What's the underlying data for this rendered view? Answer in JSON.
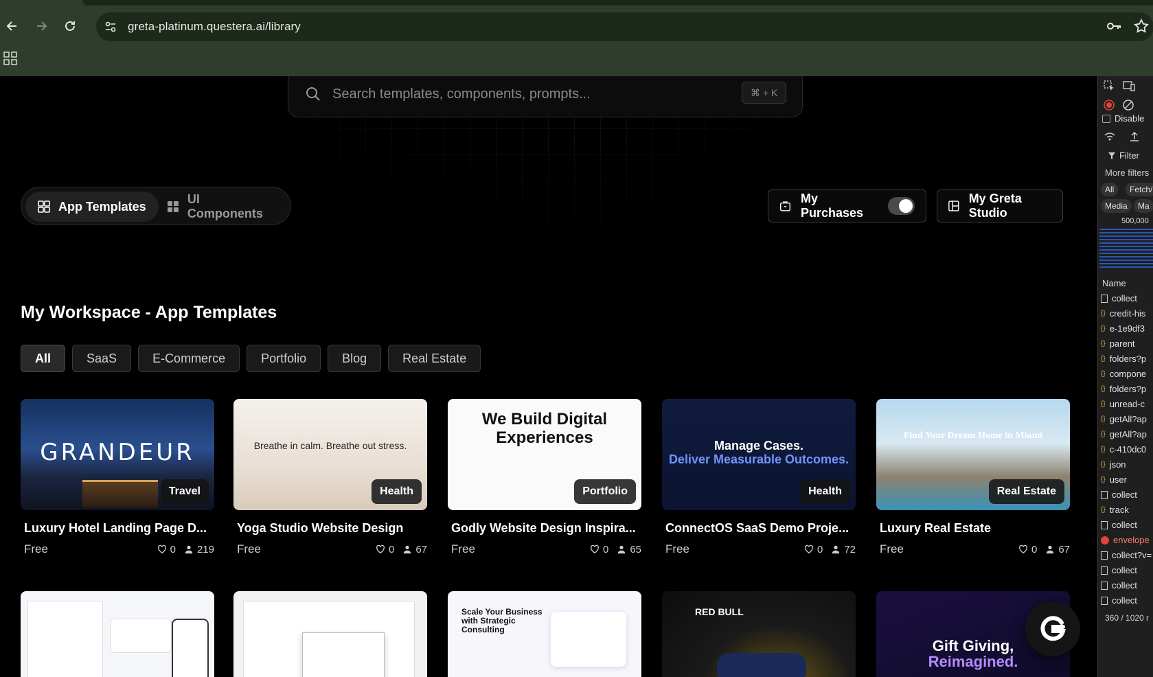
{
  "browser": {
    "url": "greta-platinum.questera.ai/library"
  },
  "search": {
    "placeholder": "Search templates, components, prompts...",
    "shortcut": "⌘ + K"
  },
  "segments": [
    {
      "label": "App Templates",
      "active": true
    },
    {
      "label": "UI Components",
      "active": false
    }
  ],
  "actions": {
    "purchases_label": "My Purchases",
    "purchases_toggle_on": true,
    "studio_label": "My Greta Studio"
  },
  "section": {
    "title": "My Workspace - App Templates"
  },
  "filters": [
    {
      "label": "All",
      "active": true
    },
    {
      "label": "SaaS",
      "active": false
    },
    {
      "label": "E-Commerce",
      "active": false
    },
    {
      "label": "Portfolio",
      "active": false
    },
    {
      "label": "Blog",
      "active": false
    },
    {
      "label": "Real Estate",
      "active": false
    }
  ],
  "cards": [
    {
      "title": "Luxury Hotel Landing Page D...",
      "tag": "Travel",
      "price": "Free",
      "likes": "0",
      "users": "219",
      "thumb_text": "GRANDEUR"
    },
    {
      "title": "Yoga Studio Website Design",
      "tag": "Health",
      "price": "Free",
      "likes": "0",
      "users": "67",
      "thumb_text": "Breathe in calm. Breathe out stress."
    },
    {
      "title": "Godly Website Design Inspira...",
      "tag": "Portfolio",
      "price": "Free",
      "likes": "0",
      "users": "65",
      "thumb_text": "We Build Digital Experiences"
    },
    {
      "title": "ConnectOS SaaS Demo Proje...",
      "tag": "Health",
      "price": "Free",
      "likes": "0",
      "users": "72",
      "thumb_text_1": "Manage Cases.",
      "thumb_text_2": "Deliver Measurable Outcomes."
    },
    {
      "title": "Luxury Real Estate",
      "tag": "Real Estate",
      "price": "Free",
      "likes": "0",
      "users": "67",
      "thumb_text": "Find Your Dream Home in Miami"
    }
  ],
  "cards_row2": [
    {
      "thumb_text": ""
    },
    {
      "thumb_text": ""
    },
    {
      "thumb_text": "Scale Your Business with Strategic Consulting"
    },
    {
      "thumb_text": "RED BULL"
    },
    {
      "thumb_text_1": "Gift Giving,",
      "thumb_text_2": "Reimagined."
    }
  ],
  "devtools": {
    "disable": "Disable",
    "filter": "Filter",
    "more_filters": "More filters",
    "chips": [
      "All",
      "Fetch/",
      "Media",
      "Ma"
    ],
    "scale": "500,000",
    "name_header": "Name",
    "requests": [
      "collect",
      "credit-his",
      "e-1e9df3",
      "parent",
      "folders?p",
      "compone",
      "folders?p",
      "unread-c",
      "getAll?ap",
      "getAll?ap",
      "c-410dc0",
      "json",
      "user",
      "collect",
      "track",
      "collect",
      "envelope",
      "collect?v=",
      "collect",
      "collect",
      "collect"
    ],
    "footer": "360 / 1020 r"
  },
  "colors": {
    "chrome": "#2f3d2c",
    "accent_blue": "#4f7cff",
    "miami_gold": "#f2b632",
    "error_red": "#e0443a"
  }
}
